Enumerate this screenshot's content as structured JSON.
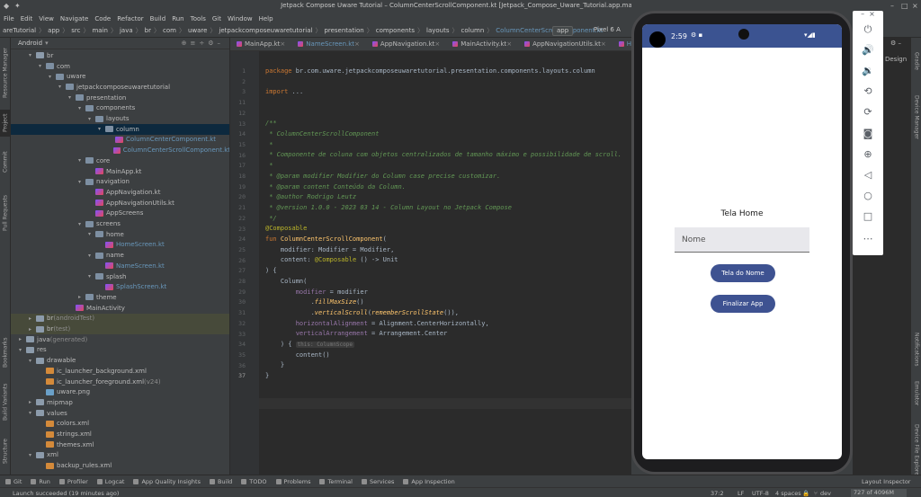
{
  "window": {
    "title": "Jetpack Compose Uware Tutorial – ColumnCenterScrollComponent.kt [Jetpack_Compose_Uware_Tutorial.app.main]"
  },
  "menu": [
    "File",
    "Edit",
    "View",
    "Navigate",
    "Code",
    "Refactor",
    "Build",
    "Run",
    "Tools",
    "Git",
    "Window",
    "Help"
  ],
  "breadcrumbs": [
    "areTutorial",
    "app",
    "src",
    "main",
    "java",
    "br",
    "com",
    "uware",
    "jetpackcomposeuwaretutorial",
    "presentation",
    "components",
    "layouts",
    "column",
    "ColumnCenterScrollComponent.kt"
  ],
  "run_config": "app",
  "device": "Pixel 6 A",
  "project_panel": {
    "view_label": "Android"
  },
  "left_strip": [
    "Resource Manager",
    "Project",
    "Commit",
    "Pull Requests",
    "Bookmarks",
    "Build Variants",
    "Structure"
  ],
  "right_strip": [
    "Gradle",
    "Device Manager",
    "Notifications",
    "Emulator",
    "Device File Explorer"
  ],
  "right_panel": {
    "design_label": "Design"
  },
  "tree": [
    {
      "indent": 2,
      "arrow": "▾",
      "icon": "folder",
      "label": "br",
      "cls": "c-std"
    },
    {
      "indent": 3,
      "arrow": "▾",
      "icon": "pkg",
      "label": "com",
      "cls": "c-std"
    },
    {
      "indent": 4,
      "arrow": "▾",
      "icon": "pkg",
      "label": "uware",
      "cls": "c-std"
    },
    {
      "indent": 5,
      "arrow": "▾",
      "icon": "pkg",
      "label": "jetpackcomposeuwaretutorial",
      "cls": "c-std"
    },
    {
      "indent": 6,
      "arrow": "▾",
      "icon": "pkg",
      "label": "presentation",
      "cls": "c-std"
    },
    {
      "indent": 7,
      "arrow": "▾",
      "icon": "pkg",
      "label": "components",
      "cls": "c-std"
    },
    {
      "indent": 8,
      "arrow": "▾",
      "icon": "pkg",
      "label": "layouts",
      "cls": "c-std"
    },
    {
      "indent": 9,
      "arrow": "▾",
      "icon": "pkg",
      "label": "column",
      "cls": "c-std",
      "row": "sel"
    },
    {
      "indent": 10,
      "arrow": "",
      "icon": "kt",
      "label": "ColumnCenterComponent.kt",
      "cls": "c-blue"
    },
    {
      "indent": 10,
      "arrow": "",
      "icon": "kt",
      "label": "ColumnCenterScrollComponent.kt",
      "cls": "c-blue"
    },
    {
      "indent": 7,
      "arrow": "▾",
      "icon": "pkg",
      "label": "core",
      "cls": "c-std"
    },
    {
      "indent": 8,
      "arrow": "",
      "icon": "kt",
      "label": "MainApp.kt",
      "cls": "c-std"
    },
    {
      "indent": 7,
      "arrow": "▾",
      "icon": "pkg",
      "label": "navigation",
      "cls": "c-std"
    },
    {
      "indent": 8,
      "arrow": "",
      "icon": "kt",
      "label": "AppNavigation.kt",
      "cls": "c-std"
    },
    {
      "indent": 8,
      "arrow": "",
      "icon": "kt",
      "label": "AppNavigationUtils.kt",
      "cls": "c-std"
    },
    {
      "indent": 8,
      "arrow": "",
      "icon": "kt",
      "label": "AppScreens",
      "cls": "c-std"
    },
    {
      "indent": 7,
      "arrow": "▾",
      "icon": "pkg",
      "label": "screens",
      "cls": "c-std"
    },
    {
      "indent": 8,
      "arrow": "▾",
      "icon": "pkg",
      "label": "home",
      "cls": "c-std"
    },
    {
      "indent": 9,
      "arrow": "",
      "icon": "kt",
      "label": "HomeScreen.kt",
      "cls": "c-blue"
    },
    {
      "indent": 8,
      "arrow": "▾",
      "icon": "pkg",
      "label": "name",
      "cls": "c-std"
    },
    {
      "indent": 9,
      "arrow": "",
      "icon": "kt",
      "label": "NameScreen.kt",
      "cls": "c-blue"
    },
    {
      "indent": 8,
      "arrow": "▾",
      "icon": "pkg",
      "label": "splash",
      "cls": "c-std"
    },
    {
      "indent": 9,
      "arrow": "",
      "icon": "kt",
      "label": "SplashScreen.kt",
      "cls": "c-blue"
    },
    {
      "indent": 7,
      "arrow": "▸",
      "icon": "pkg",
      "label": "theme",
      "cls": "c-std"
    },
    {
      "indent": 6,
      "arrow": "",
      "icon": "kt",
      "label": "MainActivity",
      "cls": "c-std"
    },
    {
      "indent": 2,
      "arrow": "▸",
      "icon": "folder",
      "label": "br",
      "suffix": " (androidTest)",
      "cls": "c-std",
      "row": "green"
    },
    {
      "indent": 2,
      "arrow": "▸",
      "icon": "folder",
      "label": "br",
      "suffix": " (test)",
      "cls": "c-std",
      "row": "green"
    },
    {
      "indent": 1,
      "arrow": "▸",
      "icon": "folder",
      "label": "java",
      "suffix": " (generated)",
      "cls": "c-std"
    },
    {
      "indent": 1,
      "arrow": "▾",
      "icon": "folder",
      "label": "res",
      "cls": "c-std"
    },
    {
      "indent": 2,
      "arrow": "▾",
      "icon": "folder",
      "label": "drawable",
      "cls": "c-std"
    },
    {
      "indent": 3,
      "arrow": "",
      "icon": "xml",
      "label": "ic_launcher_background.xml",
      "cls": "c-std"
    },
    {
      "indent": 3,
      "arrow": "",
      "icon": "xml",
      "label": "ic_launcher_foreground.xml",
      "suffix": " (v24)",
      "cls": "c-std"
    },
    {
      "indent": 3,
      "arrow": "",
      "icon": "png",
      "label": "uware.png",
      "cls": "c-std"
    },
    {
      "indent": 2,
      "arrow": "▸",
      "icon": "folder",
      "label": "mipmap",
      "cls": "c-std"
    },
    {
      "indent": 2,
      "arrow": "▾",
      "icon": "folder",
      "label": "values",
      "cls": "c-std"
    },
    {
      "indent": 3,
      "arrow": "",
      "icon": "xml",
      "label": "colors.xml",
      "cls": "c-std"
    },
    {
      "indent": 3,
      "arrow": "",
      "icon": "xml",
      "label": "strings.xml",
      "cls": "c-std"
    },
    {
      "indent": 3,
      "arrow": "",
      "icon": "xml",
      "label": "themes.xml",
      "cls": "c-std"
    },
    {
      "indent": 2,
      "arrow": "▾",
      "icon": "folder",
      "label": "xml",
      "cls": "c-std"
    },
    {
      "indent": 3,
      "arrow": "",
      "icon": "xml",
      "label": "backup_rules.xml",
      "cls": "c-std"
    }
  ],
  "tabs": [
    {
      "label": "MainApp.kt",
      "active": false
    },
    {
      "label": "NameScreen.kt",
      "active": false
    },
    {
      "label": "AppNavigation.kt",
      "active": false
    },
    {
      "label": "MainActivity.kt",
      "active": false
    },
    {
      "label": "AppNavigationUtils.kt",
      "active": false
    },
    {
      "label": "HomeScre",
      "active": false
    }
  ],
  "code": [
    {
      "n": 1,
      "segs": [
        [
          "kw",
          "package "
        ],
        [
          "",
          "br.com.uware.jetpackcomposeuwaretutorial.presentation.components.layouts.column"
        ]
      ]
    },
    {
      "n": 2,
      "segs": []
    },
    {
      "n": 3,
      "segs": [
        [
          "kw",
          "import "
        ],
        [
          "",
          "..."
        ]
      ]
    },
    {
      "n": 11,
      "segs": []
    },
    {
      "n": 12,
      "segs": []
    },
    {
      "n": 13,
      "segs": [
        [
          "cm",
          "/**"
        ]
      ]
    },
    {
      "n": 14,
      "segs": [
        [
          "cm",
          " * ColumnCenterScrollComponent"
        ]
      ]
    },
    {
      "n": 15,
      "segs": [
        [
          "cm",
          " *"
        ]
      ]
    },
    {
      "n": 16,
      "segs": [
        [
          "cm",
          " * Componente de coluna com objetos centralizados de tamanho máximo e possibilidade de scroll."
        ]
      ]
    },
    {
      "n": 17,
      "segs": [
        [
          "cm",
          " *"
        ]
      ]
    },
    {
      "n": 18,
      "segs": [
        [
          "cm",
          " * @param modifier Modifier do Column case precise customizar."
        ]
      ]
    },
    {
      "n": 19,
      "segs": [
        [
          "cm",
          " * @param content Conteúdo da Column."
        ]
      ]
    },
    {
      "n": 20,
      "segs": [
        [
          "cm",
          " * @author Rodrigo Leutz"
        ]
      ]
    },
    {
      "n": 21,
      "segs": [
        [
          "cm",
          " * @version 1.0.0 - 2023 03 14 - Column Layout no Jetpack Compose"
        ]
      ]
    },
    {
      "n": 22,
      "segs": [
        [
          "cm",
          " */"
        ]
      ]
    },
    {
      "n": 23,
      "segs": [
        [
          "ann",
          "@Composable"
        ]
      ]
    },
    {
      "n": 24,
      "segs": [
        [
          "kw",
          "fun "
        ],
        [
          "fn",
          "ColumnCenterScrollComponent"
        ],
        [
          "",
          "("
        ]
      ]
    },
    {
      "n": 25,
      "segs": [
        [
          "",
          "    modifier: Modifier = Modifier,"
        ]
      ]
    },
    {
      "n": 26,
      "segs": [
        [
          "",
          "    content: "
        ],
        [
          "ann",
          "@Composable"
        ],
        [
          "",
          " () -> Unit"
        ]
      ]
    },
    {
      "n": 27,
      "segs": [
        [
          "",
          ") {"
        ]
      ]
    },
    {
      "n": 28,
      "segs": [
        [
          "",
          "    Column("
        ]
      ]
    },
    {
      "n": 29,
      "segs": [
        [
          "pr",
          "        modifier"
        ],
        [
          "",
          " = modifier"
        ]
      ]
    },
    {
      "n": 30,
      "segs": [
        [
          "",
          "            ."
        ],
        [
          "it",
          "fillMaxSize"
        ],
        [
          "",
          "()"
        ]
      ]
    },
    {
      "n": 31,
      "segs": [
        [
          "",
          "            ."
        ],
        [
          "it",
          "verticalScroll"
        ],
        [
          "",
          "("
        ],
        [
          "it",
          "rememberScrollState"
        ],
        [
          "",
          "()),"
        ]
      ]
    },
    {
      "n": 32,
      "segs": [
        [
          "pr",
          "        horizontalAlignment"
        ],
        [
          "",
          " = Alignment.CenterHorizontally,"
        ]
      ]
    },
    {
      "n": 33,
      "segs": [
        [
          "pr",
          "        verticalArrangement"
        ],
        [
          "",
          " = Arrangement.Center"
        ]
      ]
    },
    {
      "n": 34,
      "segs": [
        [
          "",
          "    ) {"
        ],
        [
          "hint",
          "this: ColumnScope"
        ]
      ]
    },
    {
      "n": 35,
      "segs": [
        [
          "",
          "        content()"
        ]
      ]
    },
    {
      "n": 36,
      "segs": [
        [
          "",
          "    }"
        ]
      ]
    },
    {
      "n": 37,
      "segs": [
        [
          "",
          "}"
        ]
      ]
    }
  ],
  "phone": {
    "time": "2:59",
    "title": "Tela Home",
    "input_placeholder": "Nome",
    "button1": "Tela do Nome",
    "button2": "Finalizar App",
    "accent": "#3e5291"
  },
  "bottom_tools": [
    "Git",
    "Run",
    "Profiler",
    "Logcat",
    "App Quality Insights",
    "Build",
    "TODO",
    "Problems",
    "Terminal",
    "Services",
    "App Inspection"
  ],
  "layout_inspector": "Layout Inspector",
  "status": {
    "message": "Launch succeeded (19 minutes ago)",
    "position": "37:2",
    "line_sep": "LF",
    "encoding": "UTF-8",
    "indent": "4 spaces",
    "branch": "dev",
    "memory": "727 of 4096M"
  }
}
